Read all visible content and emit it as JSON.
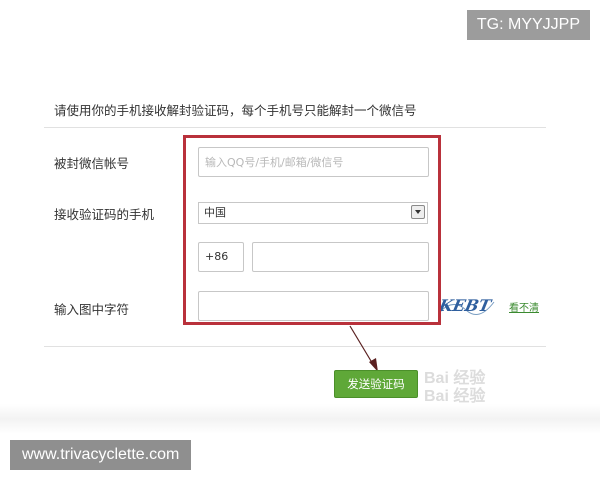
{
  "tg_badge": "TG: MYYJJPP",
  "instruction": "请使用你的手机接收解封验证码，每个手机号只能解封一个微信号",
  "form": {
    "account_label": "被封微信帐号",
    "account_placeholder": "输入QQ号/手机/邮箱/微信号",
    "phone_label": "接收验证码的手机",
    "country_value": "中国",
    "country_code": "+86",
    "phone_value": "",
    "captcha_label": "输入图中字符",
    "captcha_value": "",
    "captcha_text": "KEBT",
    "refresh_link": "看不清",
    "send_button": "发送验证码"
  },
  "watermark": {
    "line1": "Bai 经验",
    "line2": "Bai 经验"
  },
  "site_badge": "www.trivacyclette.com",
  "colors": {
    "highlight_box": "#b9313b",
    "button_green": "#5fa838",
    "link_green": "#3a8a2f"
  }
}
